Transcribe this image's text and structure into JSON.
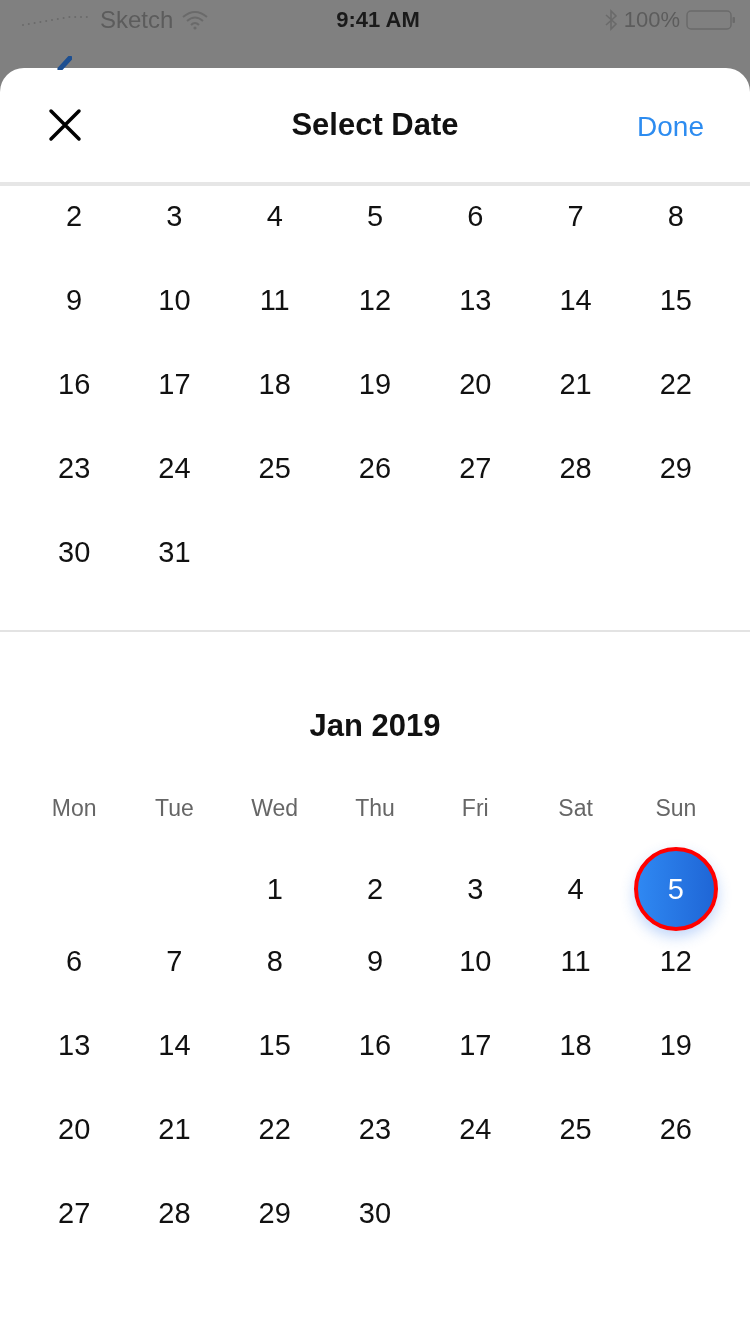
{
  "status_bar": {
    "carrier": "Sketch",
    "time": "9:41 AM",
    "battery": "100%"
  },
  "header": {
    "title": "Select Date",
    "done": "Done"
  },
  "months": [
    {
      "weeks": [
        {
          "kind": "full",
          "days": [
            {
              "text": "2",
              "selected": false
            },
            {
              "text": "3",
              "selected": false
            },
            {
              "text": "4",
              "selected": false
            },
            {
              "text": "5",
              "selected": false
            },
            {
              "text": "6",
              "selected": false
            },
            {
              "text": "7",
              "selected": false
            },
            {
              "text": "8",
              "selected": false
            }
          ]
        },
        {
          "kind": "full",
          "days": [
            {
              "text": "9",
              "selected": false
            },
            {
              "text": "10",
              "selected": false
            },
            {
              "text": "11",
              "selected": false
            },
            {
              "text": "12",
              "selected": false
            },
            {
              "text": "13",
              "selected": false
            },
            {
              "text": "14",
              "selected": false
            },
            {
              "text": "15",
              "selected": false
            }
          ]
        },
        {
          "kind": "full",
          "days": [
            {
              "text": "16",
              "selected": false
            },
            {
              "text": "17",
              "selected": false
            },
            {
              "text": "18",
              "selected": false
            },
            {
              "text": "19",
              "selected": false
            },
            {
              "text": "20",
              "selected": false
            },
            {
              "text": "21",
              "selected": false
            },
            {
              "text": "22",
              "selected": false
            }
          ]
        },
        {
          "kind": "full",
          "days": [
            {
              "text": "23",
              "selected": false
            },
            {
              "text": "24",
              "selected": false
            },
            {
              "text": "25",
              "selected": false
            },
            {
              "text": "26",
              "selected": false
            },
            {
              "text": "27",
              "selected": false
            },
            {
              "text": "28",
              "selected": false
            },
            {
              "text": "29",
              "selected": false
            }
          ]
        },
        {
          "kind": "tail",
          "days": [
            {
              "text": "30",
              "selected": false
            },
            {
              "text": "31",
              "selected": false
            }
          ]
        }
      ]
    },
    {
      "title": "Jan 2019",
      "weekdays": [
        "Mon",
        "Tue",
        "Wed",
        "Thu",
        "Fri",
        "Sat",
        "Sun"
      ],
      "weeks": [
        {
          "kind": "head",
          "days": [
            {
              "text": "1",
              "selected": false
            },
            {
              "text": "2",
              "selected": false
            },
            {
              "text": "3",
              "selected": false
            },
            {
              "text": "4",
              "selected": false
            },
            {
              "text": "5",
              "selected": true
            }
          ]
        },
        {
          "kind": "full",
          "days": [
            {
              "text": "6",
              "selected": false
            },
            {
              "text": "7",
              "selected": false
            },
            {
              "text": "8",
              "selected": false
            },
            {
              "text": "9",
              "selected": false
            },
            {
              "text": "10",
              "selected": false
            },
            {
              "text": "11",
              "selected": false
            },
            {
              "text": "12",
              "selected": false
            }
          ]
        },
        {
          "kind": "full",
          "days": [
            {
              "text": "13",
              "selected": false
            },
            {
              "text": "14",
              "selected": false
            },
            {
              "text": "15",
              "selected": false
            },
            {
              "text": "16",
              "selected": false
            },
            {
              "text": "17",
              "selected": false
            },
            {
              "text": "18",
              "selected": false
            },
            {
              "text": "19",
              "selected": false
            }
          ]
        },
        {
          "kind": "full",
          "days": [
            {
              "text": "20",
              "selected": false
            },
            {
              "text": "21",
              "selected": false
            },
            {
              "text": "22",
              "selected": false
            },
            {
              "text": "23",
              "selected": false
            },
            {
              "text": "24",
              "selected": false
            },
            {
              "text": "25",
              "selected": false
            },
            {
              "text": "26",
              "selected": false
            }
          ]
        },
        {
          "kind": "tail",
          "days": [
            {
              "text": "27",
              "selected": false
            },
            {
              "text": "28",
              "selected": false
            },
            {
              "text": "29",
              "selected": false
            },
            {
              "text": "30",
              "selected": false
            }
          ]
        }
      ]
    }
  ]
}
